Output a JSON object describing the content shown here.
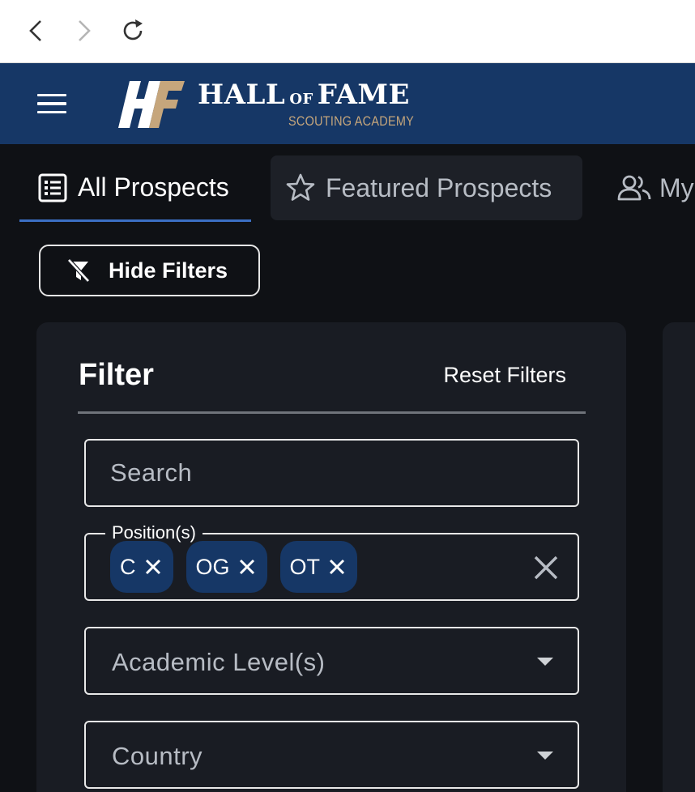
{
  "header": {
    "logo_main_left": "HALL",
    "logo_main_of": "OF",
    "logo_main_right": "FAME",
    "logo_sub": "SCOUTING ACADEMY",
    "brand_color": "#163766",
    "accent_color": "#c6a67c"
  },
  "tabs": [
    {
      "label": "All Prospects",
      "icon": "list-icon",
      "active": true
    },
    {
      "label": "Featured Prospects",
      "icon": "star-icon",
      "active": false
    },
    {
      "label": "My",
      "icon": "people-icon",
      "active": false
    }
  ],
  "hide_filters_label": "Hide Filters",
  "filter": {
    "title": "Filter",
    "reset_label": "Reset Filters",
    "search_placeholder": "Search",
    "position_legend": "Position(s)",
    "position_chips": [
      "C",
      "OG",
      "OT"
    ],
    "academic_placeholder": "Academic Level(s)",
    "country_placeholder": "Country"
  }
}
